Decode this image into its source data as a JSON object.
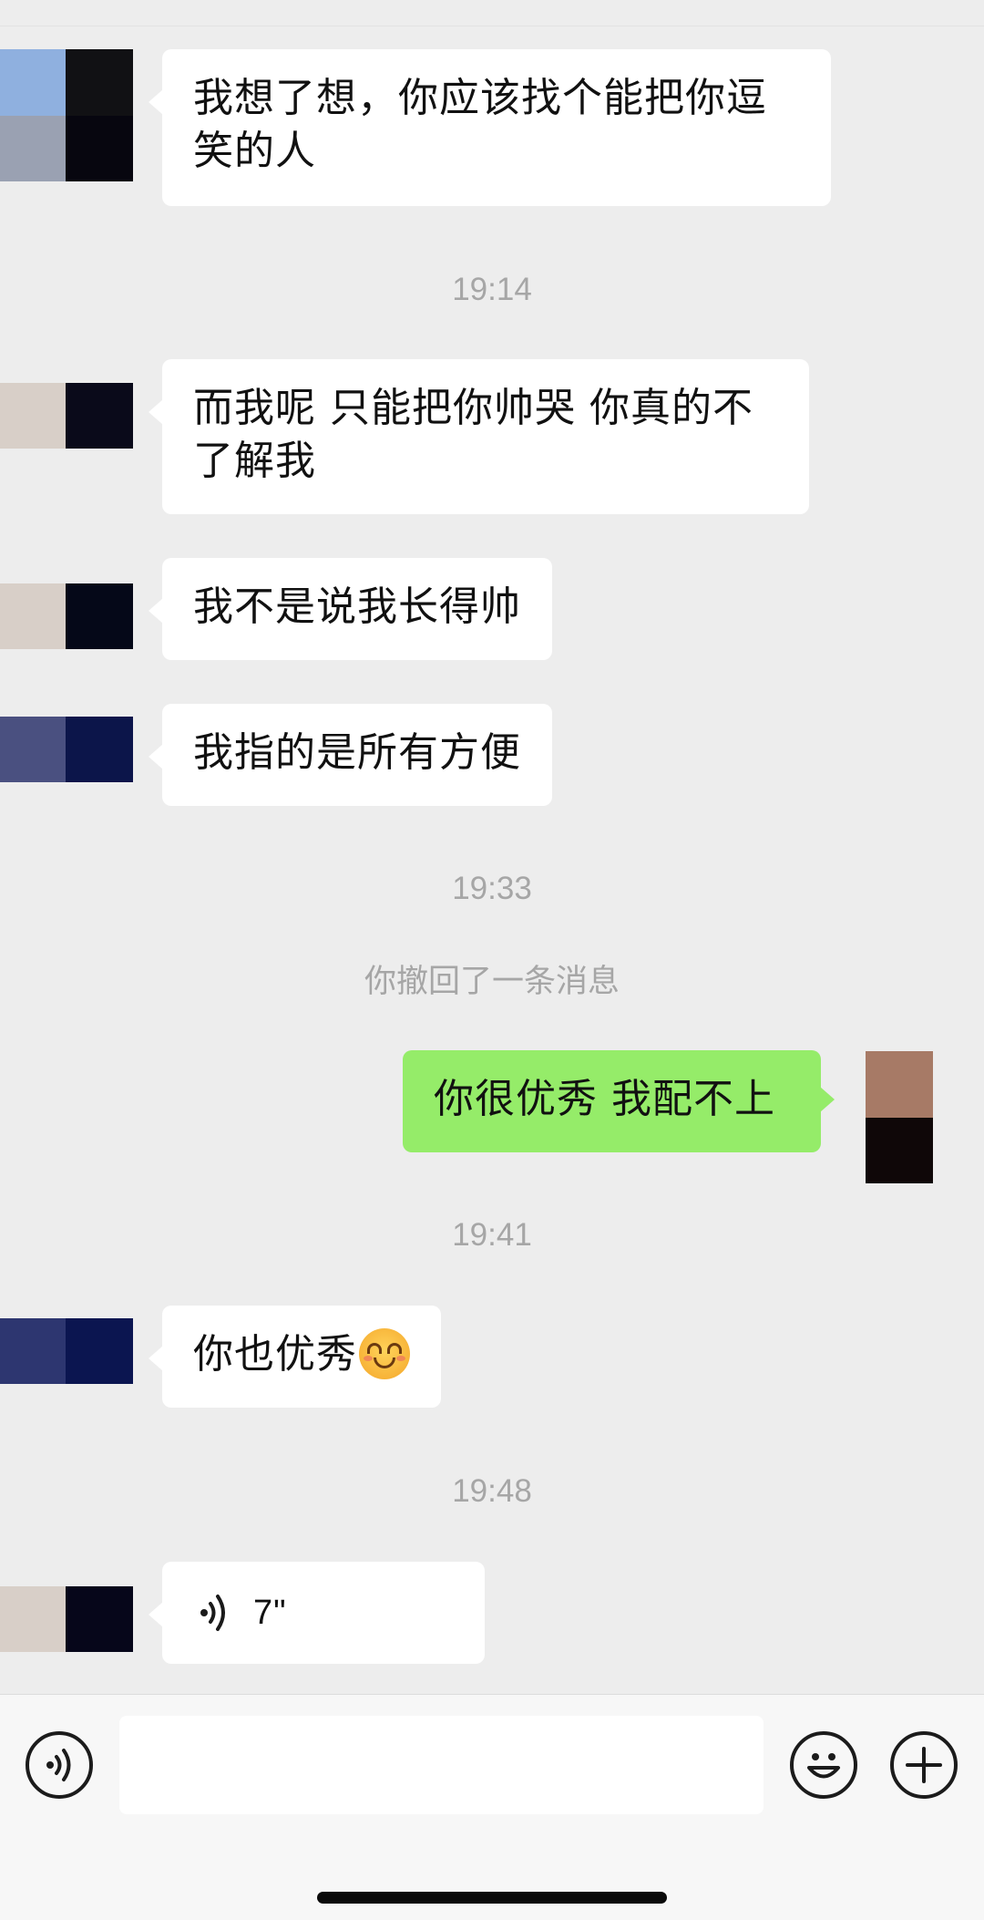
{
  "messages": [
    {
      "side": "left",
      "text_line1": "我想了想，你应该找个能把你逗",
      "text_line2": "笑的人"
    },
    {
      "type": "timestamp",
      "text": "19:14"
    },
    {
      "side": "left",
      "text_line1": "而我呢 只能把你帅哭 你真的不",
      "text_line2": "了解我"
    },
    {
      "side": "left",
      "text": "我不是说我长得帅"
    },
    {
      "side": "left",
      "text": "我指的是所有方便"
    },
    {
      "type": "timestamp",
      "text": "19:33"
    },
    {
      "type": "system",
      "text": "你撤回了一条消息"
    },
    {
      "side": "right",
      "text": "你很优秀 我配不上"
    },
    {
      "type": "timestamp",
      "text": "19:41"
    },
    {
      "side": "left",
      "text": "你也优秀",
      "emoji": "smiling-face-with-smiling-eyes"
    },
    {
      "type": "timestamp",
      "text": "19:48"
    },
    {
      "side": "left",
      "type": "voice",
      "duration": "7\""
    }
  ],
  "input_bar": {
    "voice_button_icon": "voice-mode-icon",
    "text_field_value": "",
    "emoji_button_icon": "emoji-face-icon",
    "more_button_icon": "plus-icon"
  },
  "colors": {
    "background": "#ededed",
    "incoming_bubble": "#ffffff",
    "outgoing_bubble": "#95ec69",
    "timestamp_text": "#a6a6a6"
  }
}
